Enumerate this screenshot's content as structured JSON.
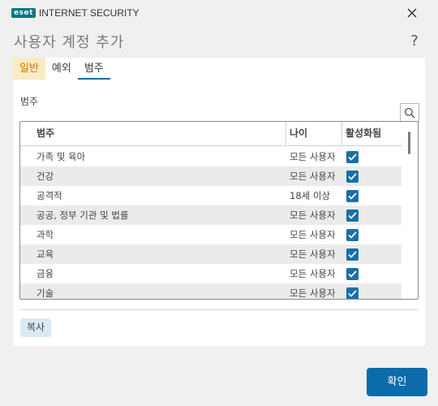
{
  "window": {
    "brand_logo_text": "eset",
    "product_name": "INTERNET SECURITY",
    "close_icon": "close-icon"
  },
  "dialog": {
    "title": "사용자 계정 추가",
    "help_label": "?"
  },
  "tabs": [
    {
      "label": "일반",
      "state": "highlighted"
    },
    {
      "label": "예외",
      "state": "normal"
    },
    {
      "label": "범주",
      "state": "selected"
    }
  ],
  "section": {
    "label": "범주",
    "search_icon": "search-icon"
  },
  "table": {
    "columns": [
      "범주",
      "나이",
      "활성화됨"
    ],
    "rows": [
      {
        "category": "가족 및 육아",
        "age": "모든 사용자",
        "enabled": true
      },
      {
        "category": "건강",
        "age": "모든 사용자",
        "enabled": true
      },
      {
        "category": "공격적",
        "age": "18세 이상",
        "enabled": true
      },
      {
        "category": "공공, 정부 기관 및 법률",
        "age": "모든 사용자",
        "enabled": true
      },
      {
        "category": "과학",
        "age": "모든 사용자",
        "enabled": true
      },
      {
        "category": "교육",
        "age": "모든 사용자",
        "enabled": true
      },
      {
        "category": "금융",
        "age": "모든 사용자",
        "enabled": true
      },
      {
        "category": "기술",
        "age": "모든 사용자",
        "enabled": true
      }
    ]
  },
  "actions": {
    "copy_label": "복사",
    "ok_label": "확인"
  },
  "colors": {
    "accent": "#0c6bab",
    "checkbox": "#1a6fa8",
    "tab_highlight_bg": "#fbebc3",
    "tab_highlight_text": "#c77a00",
    "brand": "#00777f"
  }
}
